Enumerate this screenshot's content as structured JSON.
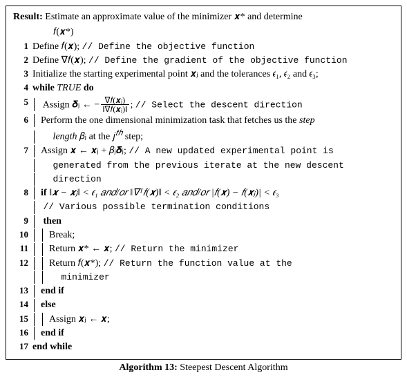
{
  "result": {
    "label": "Result:",
    "text1": "Estimate an approximate value of the minimizer 𝒙* and determine",
    "text2": "𝑓(𝒙*)"
  },
  "lines": {
    "l1": {
      "num": "1",
      "body": "Define 𝑓(𝒙);",
      "comment": "// Define the objective function"
    },
    "l2": {
      "num": "2",
      "body": "Define ∇𝑓(𝒙);",
      "comment": "// Define the gradient of the objective function"
    },
    "l3": {
      "num": "3",
      "body": "Initialize the starting experimental point 𝒙ⱼ and the tolerances 𝜖₁, 𝜖₂ and 𝜖₃;"
    },
    "l4": {
      "num": "4",
      "kw1": "while",
      "cond": "TRUE",
      "kw2": "do"
    },
    "l5": {
      "num": "5",
      "body_a": "Assign 𝜹ⱼ ← −",
      "frac_num": "∇𝑓(𝒙ⱼ)",
      "frac_den": "‖∇𝑓(𝒙ⱼ)‖",
      "body_b": ";",
      "comment": "// Select the descent direction"
    },
    "l6": {
      "num": "6",
      "body_a": "Perform the one dimensional minimization task that fetches us the ",
      "it1": "step",
      "it2": "length",
      "body_b": " 𝛽ⱼ at the 𝑗",
      "sup": "𝑡ℎ",
      "body_c": " step;"
    },
    "l7": {
      "num": "7",
      "body": "Assign 𝒙 ← 𝒙ⱼ + 𝛽ⱼ𝜹ⱼ;",
      "comment_a": "// A new updated experimental point is",
      "comment_b": "generated from the previous iterate at the new descent",
      "comment_c": "direction"
    },
    "l8": {
      "num": "8",
      "kw": "if",
      "cond": "‖𝒙 − 𝒙ⱼ‖ < 𝜖₁ 𝑎𝑛𝑑/𝑜𝑟 ‖∇ᵀ𝑓(𝒙)‖ < 𝜖₂ 𝑎𝑛𝑑/𝑜𝑟 |𝑓(𝒙) − 𝑓(𝒙ⱼ)| < 𝜖₃",
      "comment": "// Various possible termination conditions"
    },
    "l9": {
      "num": "9",
      "kw": "then"
    },
    "l10": {
      "num": "10",
      "body": "Break;"
    },
    "l11": {
      "num": "11",
      "body": "Return 𝒙* ← 𝒙;",
      "comment": "// Return the minimizer"
    },
    "l12": {
      "num": "12",
      "body": "Return 𝑓(𝒙*);",
      "comment_a": "// Return the function value at the",
      "comment_b": "minimizer"
    },
    "l13": {
      "num": "13",
      "kw": "end if"
    },
    "l14": {
      "num": "14",
      "kw": "else"
    },
    "l15": {
      "num": "15",
      "body": "Assign 𝒙ⱼ ← 𝒙;"
    },
    "l16": {
      "num": "16",
      "kw": "end if"
    },
    "l17": {
      "num": "17",
      "kw": "end while"
    }
  },
  "caption": {
    "label": "Algorithm 13:",
    "text": "Steepest Descent Algorithm"
  }
}
